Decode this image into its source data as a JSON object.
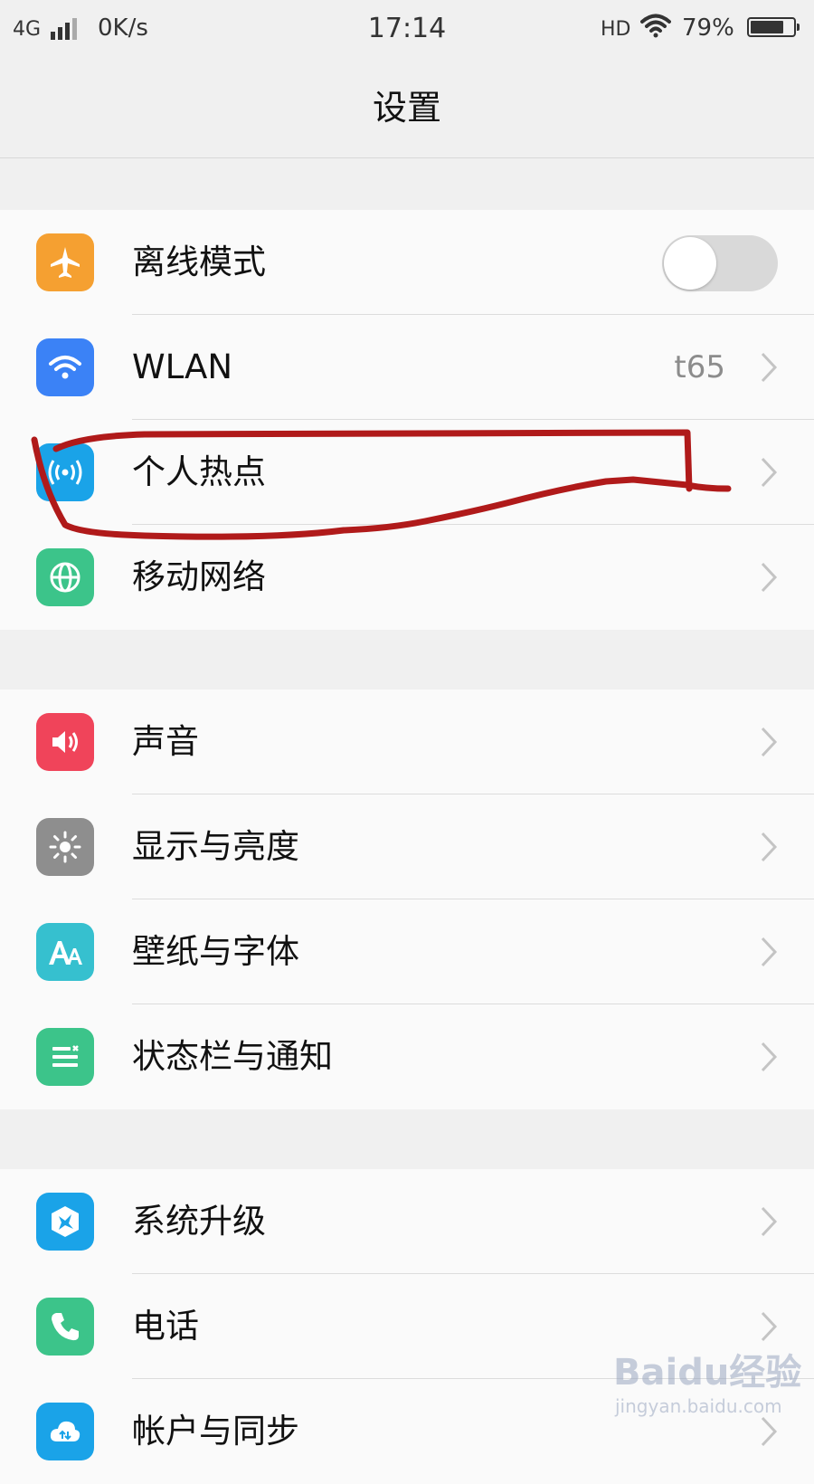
{
  "status_bar": {
    "network": "4G",
    "speed": "0K/s",
    "time": "17:14",
    "hd": "HD",
    "battery": "79%",
    "battery_level": 0.79
  },
  "header": {
    "title": "设置"
  },
  "groups": [
    {
      "items": [
        {
          "label": "离线模式",
          "icon": "airplane-icon",
          "color": "#f5a031",
          "toggle": false
        },
        {
          "label": "WLAN",
          "icon": "wifi-icon",
          "color": "#3b82f6",
          "value": "t65"
        },
        {
          "label": "个人热点",
          "icon": "hotspot-icon",
          "color": "#1aa3e8"
        },
        {
          "label": "移动网络",
          "icon": "globe-icon",
          "color": "#3cc48a"
        }
      ]
    },
    {
      "items": [
        {
          "label": "声音",
          "icon": "speaker-icon",
          "color": "#f0445a"
        },
        {
          "label": "显示与亮度",
          "icon": "brightness-icon",
          "color": "#8e8e8e"
        },
        {
          "label": "壁纸与字体",
          "icon": "font-icon",
          "color": "#36c0cf"
        },
        {
          "label": "状态栏与通知",
          "icon": "notification-icon",
          "color": "#3cc48a"
        }
      ]
    },
    {
      "items": [
        {
          "label": "系统升级",
          "icon": "system-update-icon",
          "color": "#1aa3e8"
        },
        {
          "label": "电话",
          "icon": "phone-icon",
          "color": "#3cc48a"
        },
        {
          "label": "帐户与同步",
          "icon": "cloud-sync-icon",
          "color": "#1aa3e8"
        }
      ]
    }
  ],
  "annotation_color": "#b01a1a",
  "watermark": {
    "brand": "Baidu经验",
    "site": "jingyan.baidu.com"
  }
}
